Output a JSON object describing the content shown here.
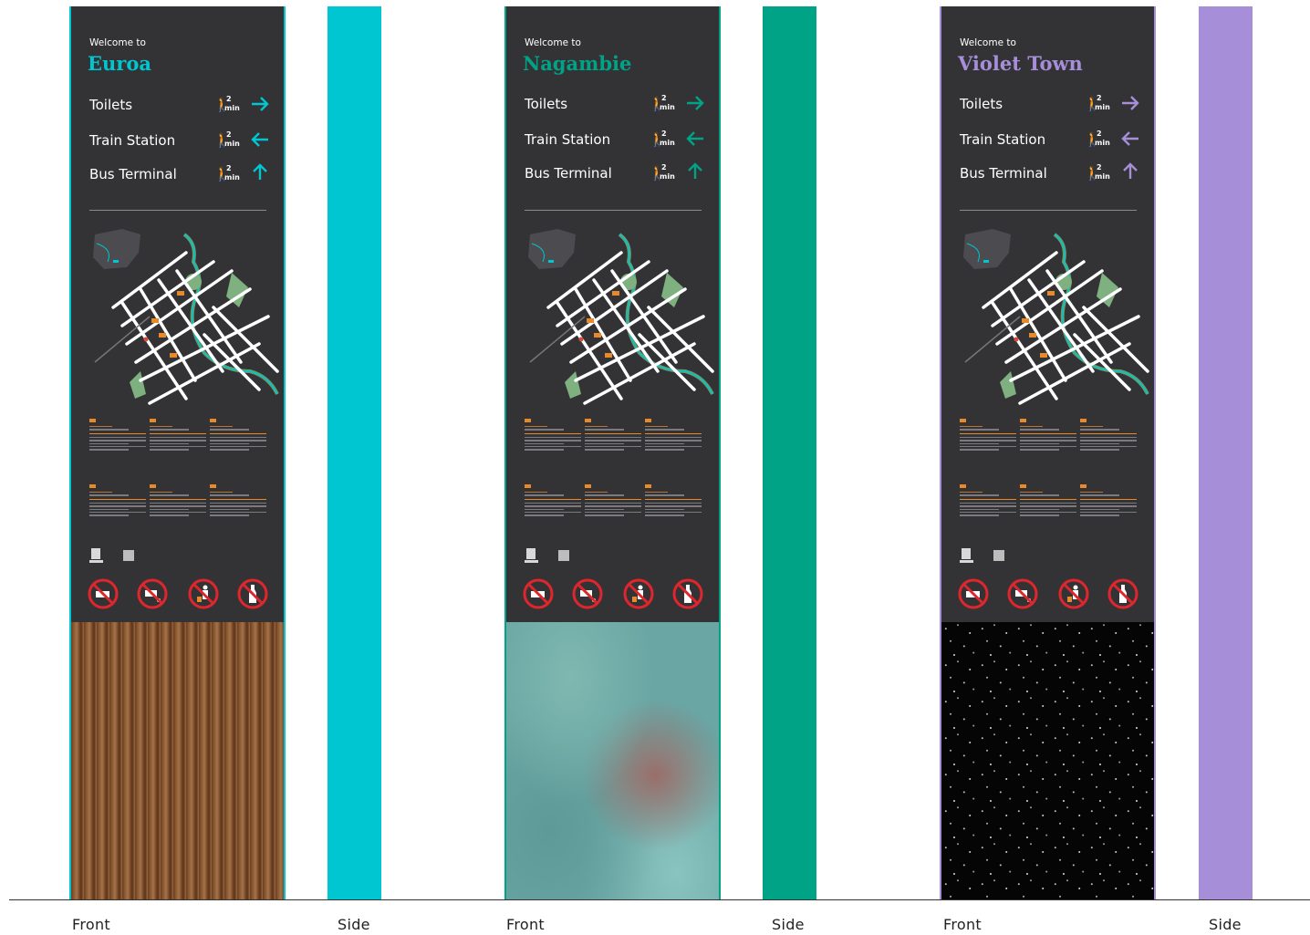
{
  "colors": {
    "panel": "#333336",
    "euroa": "#00c6d1",
    "nagambie": "#00a386",
    "violet_town": "#a78ed8",
    "info_orange": "#e88a2a"
  },
  "signs": [
    {
      "welcome": "Welcome to",
      "town": "Euroa",
      "accent": "#00c6d1",
      "base_material": "timber",
      "destinations": [
        {
          "name": "Toilets",
          "walk_minutes": "2",
          "unit": "min",
          "arrow": "right-arrow-icon"
        },
        {
          "name": "Train Station",
          "walk_minutes": "2",
          "unit": "min",
          "arrow": "left-arrow-icon"
        },
        {
          "name": "Bus Terminal",
          "walk_minutes": "2",
          "unit": "min",
          "arrow": "up-arrow-icon"
        }
      ],
      "front_label": "Front",
      "side_label": "Side"
    },
    {
      "welcome": "Welcome to",
      "town": "Nagambie",
      "accent": "#00a386",
      "base_material": "patina-stone",
      "destinations": [
        {
          "name": "Toilets",
          "walk_minutes": "2",
          "unit": "min",
          "arrow": "right-arrow-icon"
        },
        {
          "name": "Train Station",
          "walk_minutes": "2",
          "unit": "min",
          "arrow": "left-arrow-icon"
        },
        {
          "name": "Bus Terminal",
          "walk_minutes": "2",
          "unit": "min",
          "arrow": "up-arrow-icon"
        }
      ],
      "front_label": "Front",
      "side_label": "Side"
    },
    {
      "welcome": "Welcome to",
      "town": "Violet Town",
      "accent": "#a78ed8",
      "base_material": "black-granite",
      "destinations": [
        {
          "name": "Toilets",
          "walk_minutes": "2",
          "unit": "min",
          "arrow": "right-arrow-icon"
        },
        {
          "name": "Train Station",
          "walk_minutes": "2",
          "unit": "min",
          "arrow": "left-arrow-icon"
        },
        {
          "name": "Bus Terminal",
          "walk_minutes": "2",
          "unit": "min",
          "arrow": "up-arrow-icon"
        }
      ],
      "front_label": "Front",
      "side_label": "Side"
    }
  ],
  "prohibition_icons": [
    "no-dogs-icon",
    "no-dog-fouling-icon",
    "no-littering-icon",
    "no-alcohol-icon"
  ]
}
